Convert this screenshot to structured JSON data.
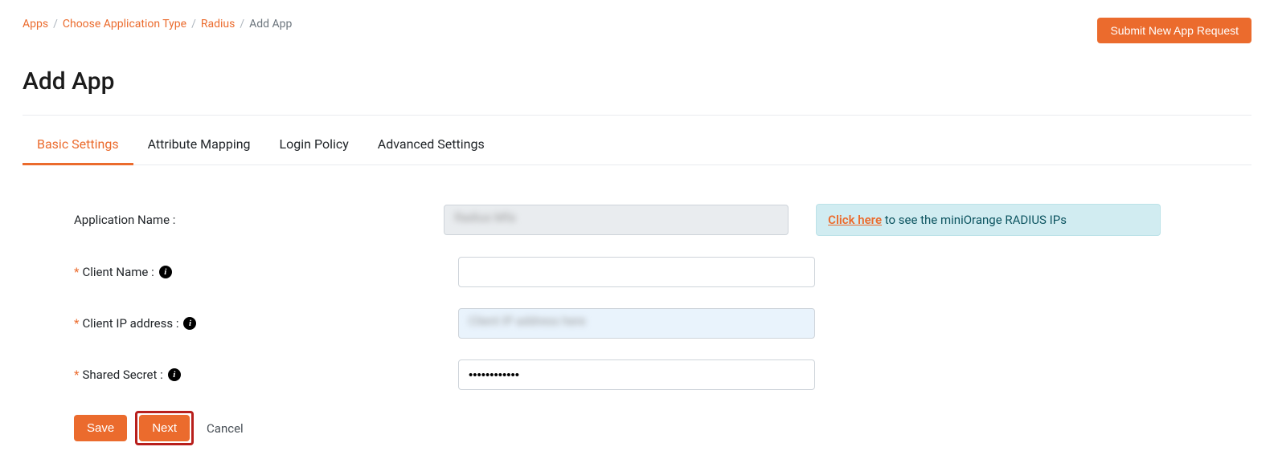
{
  "breadcrumb": {
    "items": [
      "Apps",
      "Choose Application Type",
      "Radius"
    ],
    "current": "Add App"
  },
  "header": {
    "submit_btn": "Submit New App Request",
    "title": "Add App"
  },
  "tabs": [
    "Basic Settings",
    "Attribute Mapping",
    "Login Policy",
    "Advanced Settings"
  ],
  "form": {
    "appname_label": "Application Name :",
    "appname_value": "Radius   Mfa",
    "clientname_label": "Client Name :",
    "clientname_value": "",
    "clientip_label": "Client IP address :",
    "clientip_value": "Client IP address here",
    "sharedsecret_label": "Shared Secret :",
    "sharedsecret_value": "••••••••••••"
  },
  "infobox": {
    "link": "Click here",
    "text": " to see the miniOrange RADIUS IPs"
  },
  "buttons": {
    "save": "Save",
    "next": "Next",
    "cancel": "Cancel"
  }
}
